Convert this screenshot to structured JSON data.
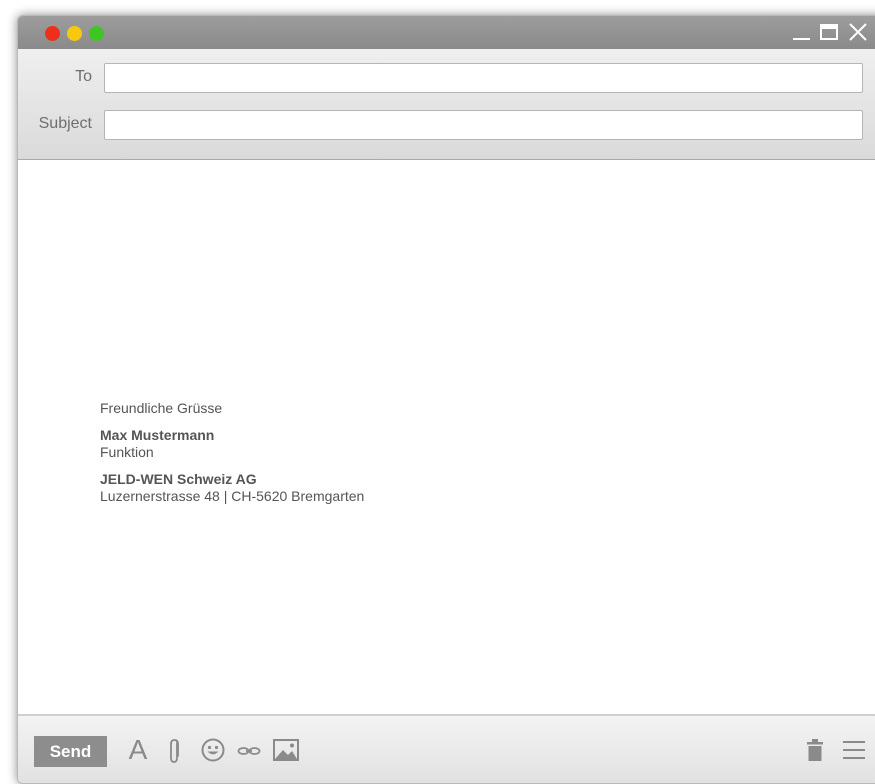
{
  "window": {
    "traffic_lights": [
      "close",
      "minimize",
      "zoom"
    ],
    "controls": [
      "minimize-icon",
      "maximize-icon",
      "close-icon"
    ]
  },
  "header": {
    "to_label": "To",
    "to_value": "",
    "subject_label": "Subject",
    "subject_value": ""
  },
  "body": {
    "greeting": "Freundliche Grüsse",
    "name": "Max Mustermann",
    "role": "Funktion",
    "company": "JELD-WEN Schweiz AG",
    "address": "Luzernerstrasse 48 | CH-5620 Bremgarten"
  },
  "toolbar": {
    "send_label": "Send",
    "font_label": "A",
    "icons": [
      "font-icon",
      "paperclip-icon",
      "emoji-icon",
      "link-icon",
      "image-icon",
      "trash-icon",
      "menu-icon"
    ]
  },
  "colors": {
    "close": "#ee2f1c",
    "minimize": "#f6c90f",
    "zoom": "#3ec623",
    "send_button": "#8d8d8d"
  }
}
